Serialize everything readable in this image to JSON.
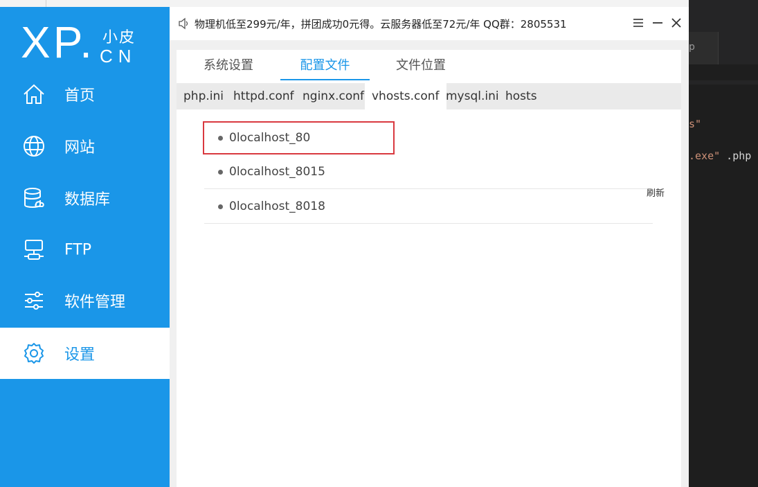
{
  "bg_editor": {
    "tab_fragment": "p",
    "code_line1": "s\"",
    "code_line2_str": ".exe\"",
    "code_line2_txt": " .php"
  },
  "sidebar": {
    "logo": {
      "main": "XP.",
      "small": "小皮",
      "cn": "CN"
    },
    "items": [
      {
        "label": "首页",
        "icon": "home-icon"
      },
      {
        "label": "网站",
        "icon": "globe-icon"
      },
      {
        "label": "数据库",
        "icon": "database-icon"
      },
      {
        "label": "FTP",
        "icon": "ftp-icon"
      },
      {
        "label": "软件管理",
        "icon": "sliders-icon"
      },
      {
        "label": "设置",
        "icon": "gear-icon",
        "active": true
      }
    ]
  },
  "titlebar": {
    "notice": "物理机低至299元/年，拼团成功0元得。云服务器低至72元/年  QQ群：2805531",
    "speaker_icon": "speaker-icon",
    "buttons": [
      "menu-icon",
      "minimize-icon",
      "close-icon"
    ]
  },
  "top_tabs": [
    {
      "label": "系统设置"
    },
    {
      "label": "配置文件",
      "active": true
    },
    {
      "label": "文件位置"
    }
  ],
  "sub_tabs": [
    {
      "label": "php.ini"
    },
    {
      "label": "httpd.conf"
    },
    {
      "label": "nginx.conf"
    },
    {
      "label": "vhosts.conf",
      "active": true
    },
    {
      "label": "mysql.ini"
    },
    {
      "label": "hosts"
    }
  ],
  "files": [
    {
      "name": "0localhost_80",
      "highlighted": true
    },
    {
      "name": "0localhost_8015"
    },
    {
      "name": "0localhost_8018"
    }
  ],
  "refresh_label": "刷新",
  "colors": {
    "accent": "#1a96e8",
    "highlight_border": "#d9383f"
  }
}
